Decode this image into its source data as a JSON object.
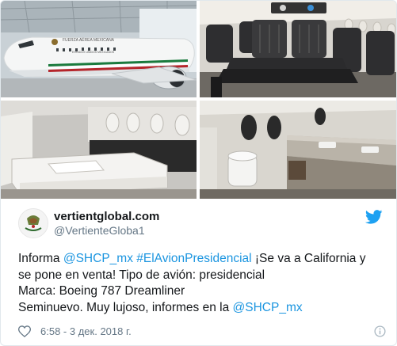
{
  "tweet": {
    "display_name": "vertientglobal.com",
    "handle": "@VertienteGloba1",
    "text": {
      "line1": {
        "prefix": "Informa ",
        "mention1": "@SHCP_mx",
        "space": " ",
        "hashtag": "#ElAvionPresidencial",
        "suffix": " ¡Se va a California y"
      },
      "line2": "se pone en venta! Tipo de avión: presidencial",
      "line3": "Marca: Boeing 787 Dreamliner",
      "line4": {
        "prefix": "Seminuevo. Muy lujoso, informes en la ",
        "mention2": "@SHCP_mx"
      }
    },
    "likes": "6:58",
    "timestamp_sep": " - ",
    "date": "3 дек. 2018 г."
  },
  "photos": {
    "plane_livery_line1": "FUERZA AÉREA MEXICANA",
    "plane_livery_line2": "ESTADOS UNIDOS MEXICANOS"
  },
  "icons": {
    "brand": "twitter-bird-icon",
    "like": "heart-icon",
    "info": "info-icon"
  },
  "colors": {
    "link": "#1b95e0",
    "twitter_blue": "#1da1f2",
    "muted": "#657786",
    "text": "#14171a",
    "border": "#e1e8ed"
  }
}
